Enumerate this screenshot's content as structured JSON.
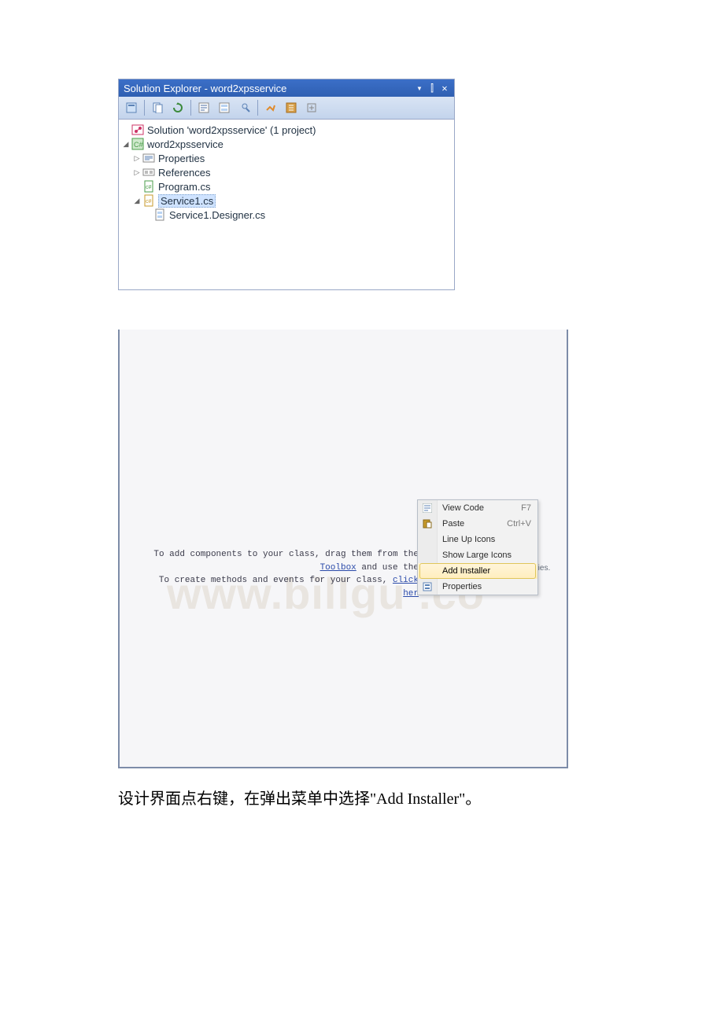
{
  "solution_explorer": {
    "title": "Solution Explorer - word2xpsservice",
    "win_buttons": {
      "dropdown": "▾",
      "pin": "⫿",
      "close": "✕"
    },
    "toolbar_icons": [
      "properties",
      "show-all",
      "refresh",
      "view-code",
      "view-designer",
      "class-view",
      "sync",
      "nest",
      "expand"
    ],
    "nodes": {
      "solution": "Solution 'word2xpsservice' (1 project)",
      "project": "word2xpsservice",
      "properties": "Properties",
      "references": "References",
      "program": "Program.cs",
      "service1": "Service1.cs",
      "service1_designer": "Service1.Designer.cs"
    }
  },
  "designer": {
    "hint_line1_a": "To add components to your class, drag them from the ",
    "hint_line1_link": "Toolbox",
    "hint_line1_b": " and use the",
    "hint_line2_a": "To create methods and events for your class, ",
    "hint_line2_link": "click her",
    "trail": "properties.",
    "watermark": "www.billgu .co"
  },
  "context_menu": {
    "items": [
      {
        "label": "View Code",
        "shortcut": "F7",
        "icon": "code"
      },
      {
        "label": "Paste",
        "shortcut": "Ctrl+V",
        "icon": "paste"
      },
      {
        "label": "Line Up Icons",
        "shortcut": "",
        "icon": ""
      },
      {
        "label": "Show Large Icons",
        "shortcut": "",
        "icon": ""
      },
      {
        "label": "Add Installer",
        "shortcut": "",
        "icon": "",
        "highlight": true
      },
      {
        "label": "Properties",
        "shortcut": "",
        "icon": "props"
      }
    ]
  },
  "caption": "设计界面点右键，在弹出菜单中选择\"Add Installer\"。"
}
